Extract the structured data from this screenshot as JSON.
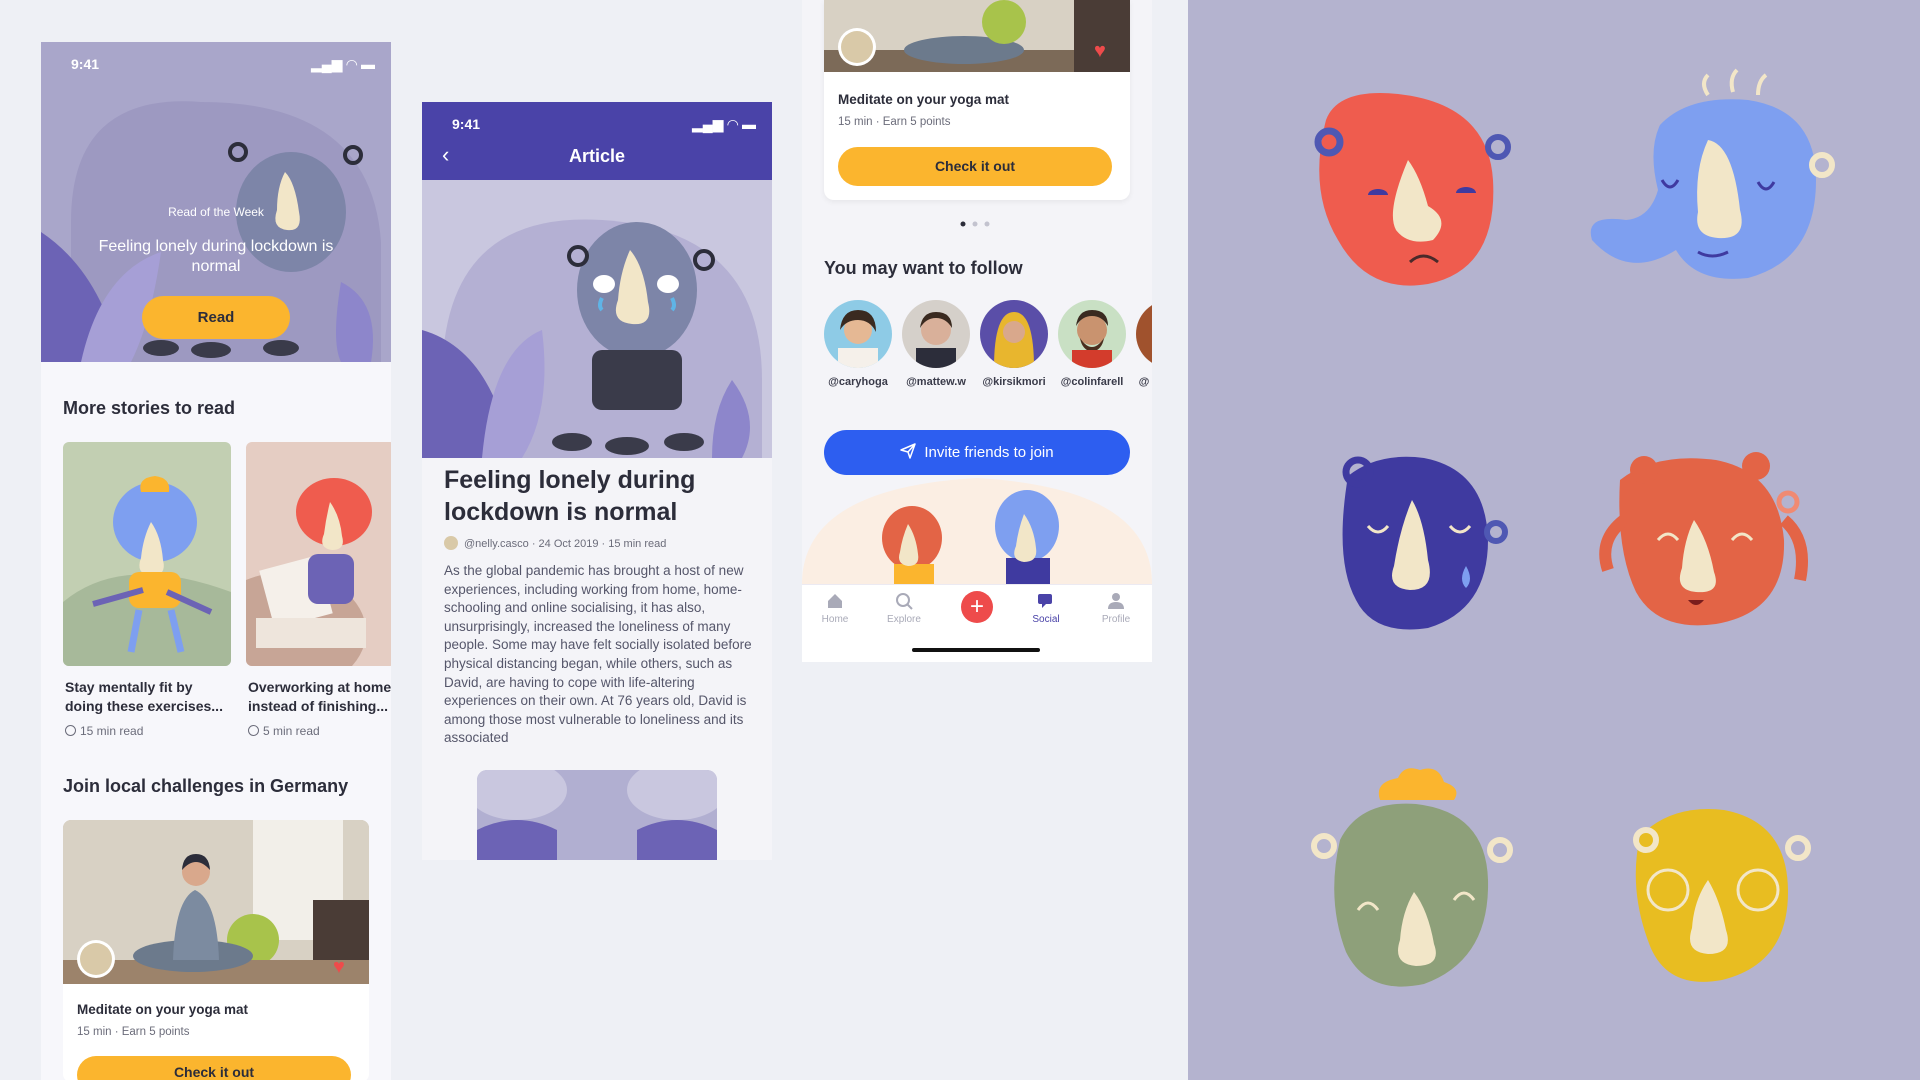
{
  "phone1": {
    "status_time": "9:41",
    "hero": {
      "kicker": "Read of the Week",
      "title": "Feeling lonely during lockdown is normal",
      "button": "Read"
    },
    "more_stories_heading": "More stories to read",
    "stories": [
      {
        "title": "Stay mentally fit by doing these exercises...",
        "meta": "15 min read"
      },
      {
        "title": "Overworking at home instead of finishing...",
        "meta": "5 min read"
      }
    ],
    "challenges_heading": "Join local challenges in Germany",
    "challenge": {
      "title": "Meditate on your yoga mat",
      "meta": "15 min · Earn 5 points",
      "button": "Check it out"
    }
  },
  "phone2": {
    "status_time": "9:41",
    "nav_title": "Article",
    "title": "Feeling lonely during lockdown is normal",
    "meta": "@nelly.casco  ·  24 Oct 2019  ·  15 min read",
    "body": "As the global pandemic has brought a host of new experiences, including working from home, home-schooling and online socialising, it has also, unsurprisingly, increased the loneliness of many people. Some may have felt socially isolated before physical distancing began, while others, such as David, are having to cope with life-altering experiences on their own. At 76 years old, David is among those most vulnerable to loneliness and its associated"
  },
  "phone3": {
    "card": {
      "title": "Meditate on your yoga mat",
      "meta": "15 min · Earn 5 points",
      "button": "Check it out"
    },
    "follow_heading": "You may want to follow",
    "follow": [
      {
        "handle": "@caryhoga",
        "color": "#d9c9a8"
      },
      {
        "handle": "@mattew.w",
        "color": "#b9b3ad"
      },
      {
        "handle": "@kirsikmori",
        "color": "#c9a64a"
      },
      {
        "handle": "@colinfarell",
        "color": "#8a5a3c"
      },
      {
        "handle": "@",
        "color": "#a0522d"
      }
    ],
    "invite_button": "Invite friends to join",
    "tabs": [
      {
        "label": "Home",
        "icon": "home-icon"
      },
      {
        "label": "Explore",
        "icon": "search-icon"
      },
      {
        "label": "",
        "icon": "plus-icon"
      },
      {
        "label": "Social",
        "icon": "chat-icon"
      },
      {
        "label": "Profile",
        "icon": "profile-icon"
      }
    ]
  },
  "colors": {
    "accent_yellow": "#fbb52e",
    "accent_purple": "#4a43a8",
    "accent_blue": "#2d5ef0",
    "accent_red": "#ee4b4b",
    "panel_bg": "#b4b3cf"
  }
}
